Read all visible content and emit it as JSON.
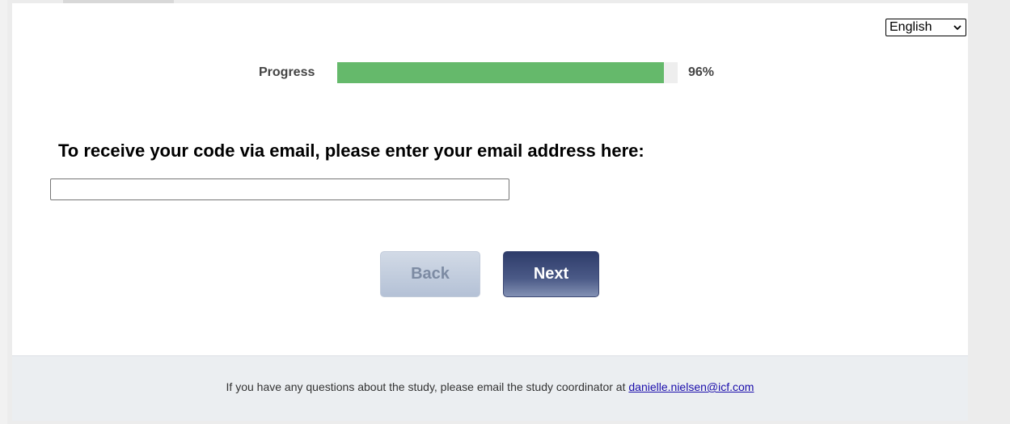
{
  "language": {
    "selected": "English",
    "options": [
      "English"
    ]
  },
  "progress": {
    "label": "Progress",
    "percent_text": "96%",
    "percent": 96
  },
  "question": {
    "text": "To receive your code via email, please enter your email address here:"
  },
  "email_input": {
    "value": "",
    "placeholder": ""
  },
  "buttons": {
    "back_label": "Back",
    "next_label": "Next"
  },
  "footer": {
    "text": "If you have any questions about the study, please email the study coordinator at ",
    "link_text": "danielle.nielsen@icf.com"
  },
  "colors": {
    "progress_fill": "#65b96b",
    "next_button": "#2e3c6a",
    "back_button": "#b4c1d6",
    "link": "#1a0dab"
  }
}
